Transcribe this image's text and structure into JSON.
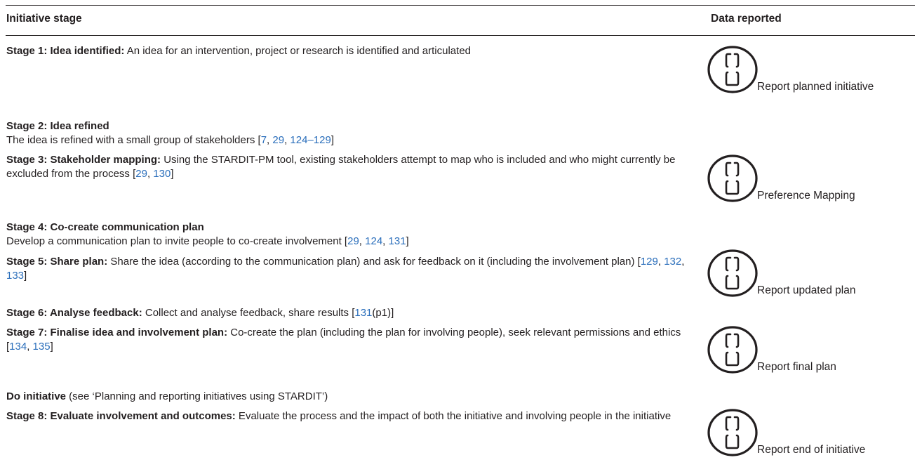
{
  "header": {
    "col_stage": "Initiative stage",
    "col_data": "Data reported"
  },
  "stages": [
    {
      "title": "Stage 1: Idea identified:",
      "text": " An idea for an intervention, project or research is identified and articulated"
    },
    {
      "title": "Stage 2: Idea refined",
      "text": "The idea is refined with a small group of stakeholders [",
      "refs": [
        "7",
        "29",
        "124–129"
      ]
    },
    {
      "title": "Stage 3: Stakeholder mapping:",
      "text": " Using the STARDIT-PM tool, existing stakeholders attempt to map who is included and who might currently be excluded from the process [",
      "refs": [
        "29",
        "130"
      ]
    },
    {
      "title": "Stage 4: Co-create communication plan",
      "text": "Develop a communication plan to invite people to co-create involvement [",
      "refs": [
        "29",
        "124",
        "131"
      ]
    },
    {
      "title": "Stage 5: Share plan:",
      "text": " Share the idea (according to the communication plan) and ask for feedback on it (including the involvement plan) [",
      "refs": [
        "129",
        "132",
        "133"
      ]
    },
    {
      "title": "Stage 6: Analyse feedback:",
      "text": " Collect and analyse feedback, share results [",
      "refs": [
        "131"
      ],
      "suffix": "(p1)]"
    },
    {
      "title": "Stage 7: Finalise idea and involvement plan:",
      "text": " Co-create the plan (including the plan for involving people), seek relevant permissions and ethics [",
      "refs": [
        "134",
        "135"
      ]
    },
    {
      "title": "Do initiative",
      "text": " (see ‘Planning and reporting initiatives using STARDIT’)"
    },
    {
      "title": "Stage 8: Evaluate involvement and outcomes:",
      "text": " Evaluate the process and the impact of both the initiative and involving people in the initiative"
    }
  ],
  "reports": [
    {
      "label": "Report planned initiative",
      "icon": "stardit-logo-icon"
    },
    {
      "label": "Preference Mapping",
      "icon": "stardit-logo-icon"
    },
    {
      "label": "Report updated plan",
      "icon": "stardit-logo-icon"
    },
    {
      "label": "Report final plan",
      "icon": "stardit-logo-icon"
    },
    {
      "label": "Report end of initiative",
      "icon": "stardit-logo-icon"
    }
  ],
  "colors": {
    "text": "#231f20",
    "link": "#2a6ebb"
  }
}
